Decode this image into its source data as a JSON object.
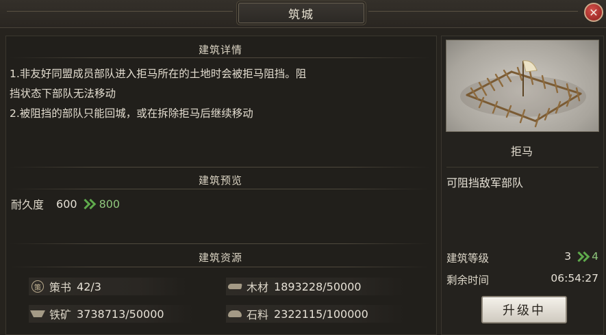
{
  "window": {
    "title": "筑城",
    "close_glyph": "✕"
  },
  "sections": {
    "details_title": "建筑详情",
    "preview_title": "建筑预览",
    "resources_title": "建筑资源"
  },
  "details": {
    "lines": [
      "1.非友好同盟成员部队进入拒马所在的土地时会被拒马阻挡。阻",
      "挡状态下部队无法移动",
      "2.被阻挡的部队只能回城，或在拆除拒马后继续移动"
    ]
  },
  "preview": {
    "durability_label": "耐久度",
    "durability_current": "600",
    "durability_next": "800"
  },
  "resources": [
    {
      "icon": "book-icon",
      "badge": "策",
      "name": "策书",
      "value": "42/3"
    },
    {
      "icon": "wood-icon",
      "name": "木材",
      "value": "1893228/50000"
    },
    {
      "icon": "iron-icon",
      "name": "铁矿",
      "value": "3738713/50000"
    },
    {
      "icon": "stone-icon",
      "name": "石料",
      "value": "2322115/100000"
    }
  ],
  "building": {
    "name": "拒马",
    "description": "可阻挡敌军部队",
    "level_label": "建筑等级",
    "level_current": "3",
    "level_next": "4",
    "time_label": "剩余时间",
    "time_value": "06:54:27",
    "upgrade_button": "升级中"
  },
  "colors": {
    "background": "#26231e",
    "increase_green": "#8fc77d",
    "close_red": "#b8312c"
  }
}
